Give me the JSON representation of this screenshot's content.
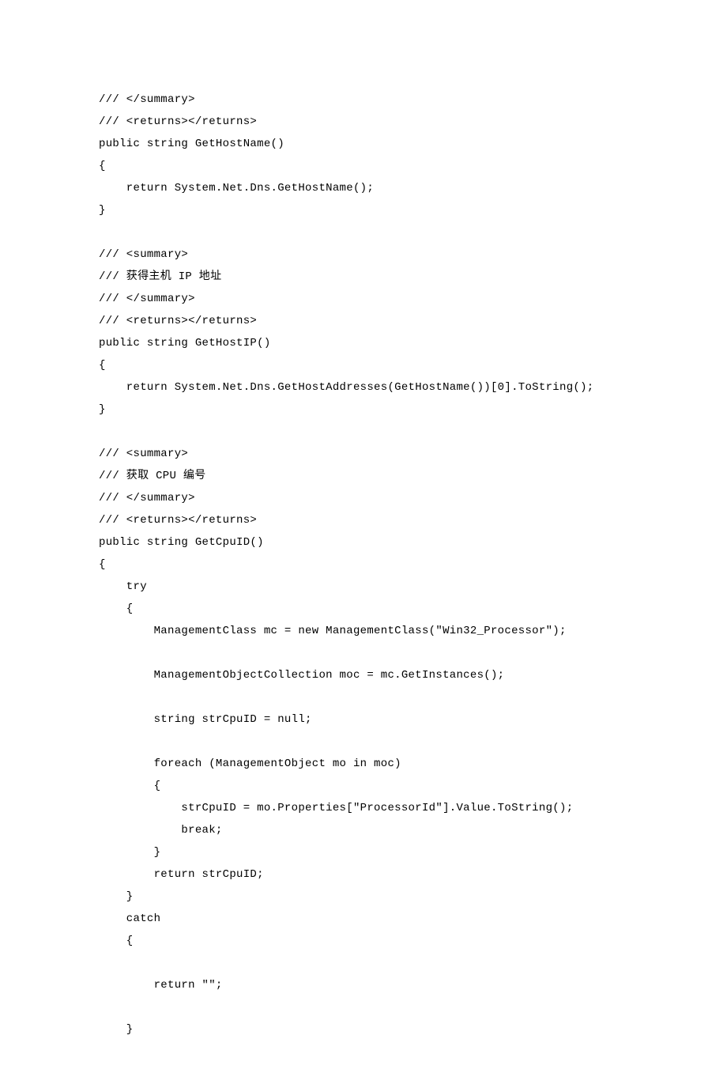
{
  "code": {
    "lines": [
      "/// </summary>",
      "/// <returns></returns>",
      "public string GetHostName()",
      "{",
      "    return System.Net.Dns.GetHostName();",
      "}",
      "",
      "/// <summary>",
      "/// 获得主机 IP 地址",
      "/// </summary>",
      "/// <returns></returns>",
      "public string GetHostIP()",
      "{",
      "    return System.Net.Dns.GetHostAddresses(GetHostName())[0].ToString();",
      "}",
      "",
      "/// <summary>",
      "/// 获取 CPU 编号",
      "/// </summary>",
      "/// <returns></returns>",
      "public string GetCpuID()",
      "{",
      "    try",
      "    {",
      "        ManagementClass mc = new ManagementClass(\"Win32_Processor\");",
      "",
      "        ManagementObjectCollection moc = mc.GetInstances();",
      "",
      "        string strCpuID = null;",
      "",
      "        foreach (ManagementObject mo in moc)",
      "        {",
      "            strCpuID = mo.Properties[\"ProcessorId\"].Value.ToString();",
      "            break;",
      "        }",
      "        return strCpuID;",
      "    }",
      "    catch",
      "    {",
      "",
      "        return \"\";",
      "",
      "    }"
    ]
  }
}
